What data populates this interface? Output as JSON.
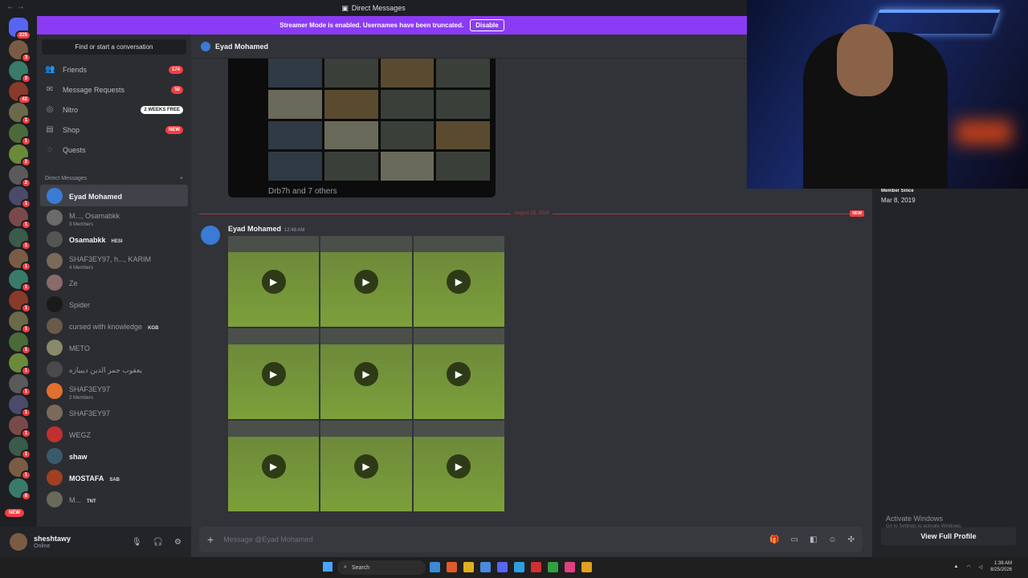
{
  "window": {
    "title": "Direct Messages"
  },
  "streamer": {
    "text": "Streamer Mode is enabled. Usernames have been truncated.",
    "button": "Disable"
  },
  "guilds": {
    "home_badge": "225",
    "badges": [
      "3",
      "3",
      "42",
      "1",
      "1",
      "2",
      "2",
      "1",
      "1",
      "1",
      "1",
      "1",
      "1",
      "1",
      "1",
      "1",
      "1",
      "1",
      "1",
      "1",
      "1",
      "8"
    ],
    "new_label": "NEW"
  },
  "sidebar": {
    "search_placeholder": "Find or start a conversation",
    "nav": [
      {
        "label": "Friends",
        "badge": "174",
        "icon": "friends-icon"
      },
      {
        "label": "Message Requests",
        "badge": "50",
        "icon": "mail-icon"
      },
      {
        "label": "Nitro",
        "badge": "2 WEEKS FREE",
        "icon": "nitro-icon"
      },
      {
        "label": "Shop",
        "badge": "NEW",
        "icon": "shop-icon"
      },
      {
        "label": "Quests",
        "badge": "",
        "icon": "quests-icon"
      }
    ],
    "dm_header": "Direct Messages",
    "dms": [
      {
        "name": "Eyad Mohamed",
        "sub": "",
        "tag": "",
        "bold": true,
        "active": true,
        "color": "#3a7bd5"
      },
      {
        "name": "M..., Osamabkk",
        "sub": "3 Members",
        "tag": "",
        "bold": false,
        "active": false,
        "color": "#6b6b6b"
      },
      {
        "name": "Osamabkk",
        "sub": "",
        "tag": "HESI",
        "bold": true,
        "active": false,
        "color": "#555"
      },
      {
        "name": "SHAF3EY97, h..., KARIM",
        "sub": "4 Members",
        "tag": "",
        "bold": false,
        "active": false,
        "color": "#7a6a5a"
      },
      {
        "name": "Ze",
        "sub": "",
        "tag": "",
        "bold": false,
        "active": false,
        "color": "#8a6a6a"
      },
      {
        "name": "Spider",
        "sub": "",
        "tag": "",
        "bold": false,
        "active": false,
        "color": "#1a1a1a"
      },
      {
        "name": "cursed with knowledge",
        "sub": "",
        "tag": "KGB",
        "bold": false,
        "active": false,
        "color": "#6a5a4a"
      },
      {
        "name": "METO",
        "sub": "",
        "tag": "",
        "bold": false,
        "active": false,
        "color": "#8a8a6a"
      },
      {
        "name": "يعقوب جمر الدين ديبيازه",
        "sub": "",
        "tag": "",
        "bold": false,
        "active": false,
        "color": "#4a4a4a"
      },
      {
        "name": "SHAF3EY97",
        "sub": "2 Members",
        "tag": "",
        "bold": false,
        "active": false,
        "color": "#e07030"
      },
      {
        "name": "SHAF3EY97",
        "sub": "",
        "tag": "",
        "bold": false,
        "active": false,
        "color": "#7a6a5a"
      },
      {
        "name": "WEGZ",
        "sub": "",
        "tag": "",
        "bold": false,
        "active": false,
        "color": "#c03030"
      },
      {
        "name": "shaw",
        "sub": "",
        "tag": "",
        "bold": true,
        "active": false,
        "color": "#3a5a6a"
      },
      {
        "name": "MOSTAFA",
        "sub": "",
        "tag": "SAB",
        "bold": true,
        "active": false,
        "color": "#a04020"
      },
      {
        "name": "M...",
        "sub": "",
        "tag": "TNT",
        "bold": false,
        "active": false,
        "color": "#6a6a5a"
      }
    ]
  },
  "user": {
    "name": "sheshtawy",
    "status": "Online"
  },
  "chat": {
    "recipient": "Eyad Mohamed",
    "embed_caption": "Drb7h and 7 others",
    "date_divider": "August 25, 2026",
    "new_label": "NEW",
    "message": {
      "author": "Eyad Mohamed",
      "time": "12:48 AM"
    },
    "composer_placeholder": "Message @Eyad Mohamed"
  },
  "profile": {
    "member_since_label": "Member Since",
    "member_since": "Mar 8, 2019",
    "activate_title": "Activate Windows",
    "activate_sub": "Go to Settings to activate Windows.",
    "view_full": "View Full Profile"
  },
  "taskbar": {
    "search": "Search",
    "time": "1:38 AM",
    "date": "8/25/2026"
  }
}
